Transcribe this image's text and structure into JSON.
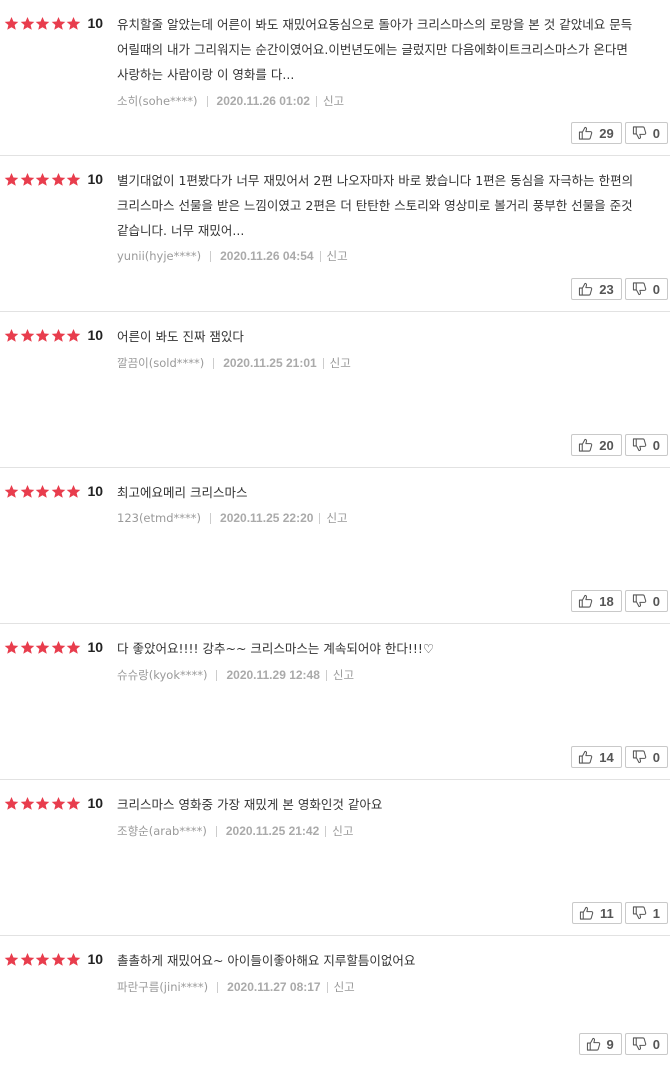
{
  "colors": {
    "star": "#e83d4d",
    "date": "#aaaaaa",
    "border": "#e2e2e2"
  },
  "reviews": [
    {
      "score": "10",
      "stars": 5,
      "text": "유치할줄 알았는데 어른이 봐도 재밌어요동심으로 돌아가 크리스마스의 로망을 본 것 같았네요 문득 어릴때의 내가 그리워지는 순간이였어요.이번년도에는 글렀지만 다음에화이트크리스마스가 온다면 사랑하는 사람이랑 이 영화를 다...",
      "user": "소히(sohe****)",
      "date": "2020.11.26 01:02",
      "report": "신고",
      "likes": "29",
      "dislikes": "0"
    },
    {
      "score": "10",
      "stars": 5,
      "text": "별기대없이 1편봤다가 너무 재밌어서 2편 나오자마자 바로 봤습니다 1편은 동심을 자극하는 한편의 크리스마스 선물을 받은 느낌이였고 2편은 더 탄탄한 스토리와 영상미로 볼거리 풍부한 선물을 준것 같습니다. 너무 재밌어...",
      "user": "yunii(hyje****)",
      "date": "2020.11.26 04:54",
      "report": "신고",
      "likes": "23",
      "dislikes": "0"
    },
    {
      "score": "10",
      "stars": 5,
      "text": "어른이 봐도 진짜 잼있다",
      "user": "깔끔이(sold****)",
      "date": "2020.11.25 21:01",
      "report": "신고",
      "likes": "20",
      "dislikes": "0"
    },
    {
      "score": "10",
      "stars": 5,
      "text": "최고에요메리 크리스마스",
      "user": "123(etmd****)",
      "date": "2020.11.25 22:20",
      "report": "신고",
      "likes": "18",
      "dislikes": "0"
    },
    {
      "score": "10",
      "stars": 5,
      "text": "다 좋았어요!!!! 강추~~ 크리스마스는 계속되어야 한다!!!♡",
      "user": "슈슈랑(kyok****)",
      "date": "2020.11.29 12:48",
      "report": "신고",
      "likes": "14",
      "dislikes": "0"
    },
    {
      "score": "10",
      "stars": 5,
      "text": "크리스마스 영화중 가장 재밌게 본 영화인것 같아요",
      "user": "조향순(arab****)",
      "date": "2020.11.25 21:42",
      "report": "신고",
      "likes": "11",
      "dislikes": "1"
    },
    {
      "score": "10",
      "stars": 5,
      "text": "촐촐하게 재밌어요~ 아이들이좋아해요 지루할틈이없어요",
      "user": "파란구름(jini****)",
      "date": "2020.11.27 08:17",
      "report": "신고",
      "likes": "9",
      "dislikes": "0"
    }
  ]
}
